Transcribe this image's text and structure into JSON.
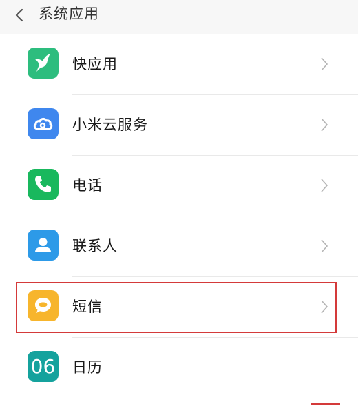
{
  "header": {
    "title": "系统应用",
    "back_icon": "chevron-left-icon"
  },
  "colors": {
    "header_bg": "#f7f7f7",
    "highlight_border": "#d43a3a",
    "kuai_icon_bg": "#2dbd7e",
    "cloud_icon_bg": "#3f87ee",
    "phone_icon_bg": "#19b85d",
    "contacts_icon_bg": "#2d9ae8",
    "sms_icon_bg": "#f7b52c",
    "calendar_icon_bg": "#15a29d"
  },
  "items": [
    {
      "label": "快应用",
      "icon": "hummingbird-icon"
    },
    {
      "label": "小米云服务",
      "icon": "cloud-icon"
    },
    {
      "label": "电话",
      "icon": "phone-icon"
    },
    {
      "label": "联系人",
      "icon": "contact-person-icon"
    },
    {
      "label": "短信",
      "icon": "message-bubble-icon",
      "highlighted": true
    },
    {
      "label": "日历",
      "icon": "calendar-icon",
      "icon_text": "06"
    }
  ]
}
